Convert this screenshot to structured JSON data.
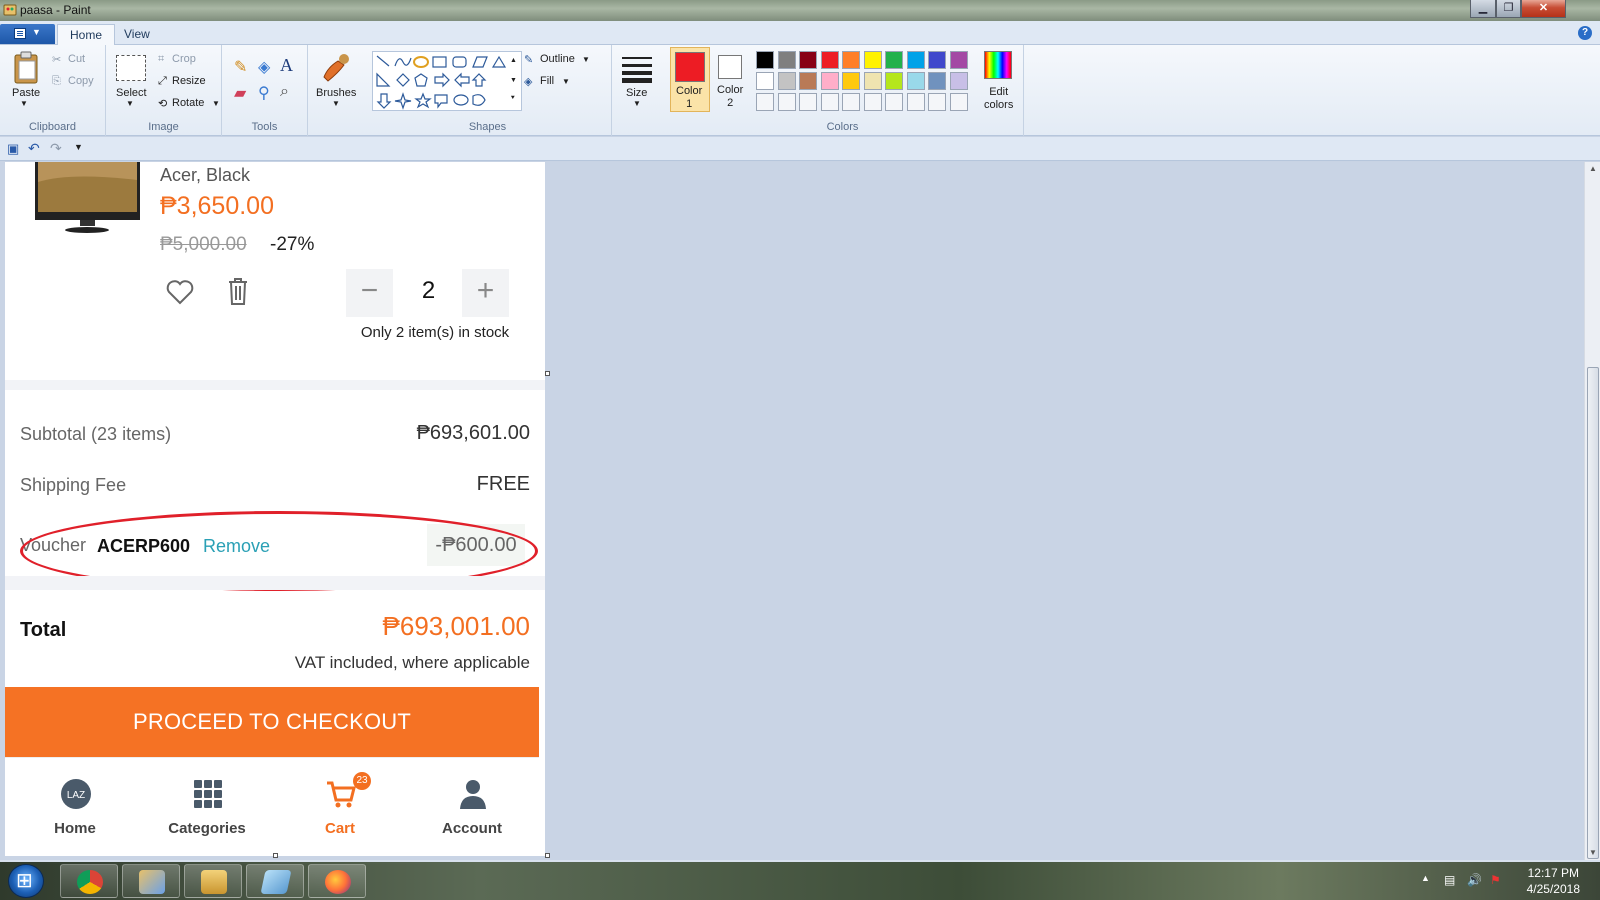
{
  "window": {
    "title": "paasa - Paint",
    "buttons": [
      "minimize",
      "maximize",
      "close"
    ]
  },
  "ribbon_tabs": [
    {
      "label": "Home",
      "active": true
    },
    {
      "label": "View",
      "active": false
    }
  ],
  "ribbon": {
    "clipboard": {
      "paste": "Paste",
      "cut": "Cut",
      "copy": "Copy",
      "group": "Clipboard"
    },
    "image": {
      "select": "Select",
      "crop": "Crop",
      "resize": "Resize",
      "rotate": "Rotate",
      "group": "Image"
    },
    "tools": {
      "group": "Tools"
    },
    "brushes": "Brushes",
    "shapes": {
      "outline": "Outline",
      "fill": "Fill",
      "group": "Shapes"
    },
    "size": "Size",
    "color1": "Color\n1",
    "color2": "Color\n2",
    "edit_colors": "Edit\ncolors",
    "colors_group": "Colors",
    "palette_row1": [
      "#000000",
      "#7f7f7f",
      "#880015",
      "#ed1c24",
      "#ff7f27",
      "#fff200",
      "#22b14c",
      "#00a2e8",
      "#3f48cc",
      "#a349a4"
    ],
    "palette_row2": [
      "#ffffff",
      "#c3c3c3",
      "#b97a57",
      "#ffaec9",
      "#ffc90e",
      "#efe4b0",
      "#b5e61d",
      "#99d9ea",
      "#7092be",
      "#c8bfe7"
    ],
    "color1_value": "#ed1c24",
    "color2_value": "#ffffff"
  },
  "canvas_content": {
    "product": {
      "name": "Acer, Black",
      "price": "₱3,650.00",
      "old_price": "₱5,000.00",
      "discount": "-27%",
      "quantity": "2",
      "stock_note": "Only 2 item(s) in stock"
    },
    "summary": {
      "subtotal_label": "Subtotal (23 items)",
      "subtotal_value": "₱693,601.00",
      "shipping_label": "Shipping Fee",
      "shipping_value": "FREE",
      "voucher_label": "Voucher",
      "voucher_code": "ACERP600",
      "voucher_remove": "Remove",
      "voucher_amount": "-₱600.00",
      "total_label": "Total",
      "total_value": "₱693,001.00",
      "vat_note": "VAT included, where applicable"
    },
    "checkout_button": "PROCEED TO CHECKOUT",
    "nav": [
      {
        "label": "Home",
        "icon": "laz-logo-icon"
      },
      {
        "label": "Categories",
        "icon": "grid-icon"
      },
      {
        "label": "Cart",
        "icon": "cart-icon",
        "badge": "23"
      },
      {
        "label": "Account",
        "icon": "person-icon"
      }
    ]
  },
  "taskbar": {
    "apps": [
      "chrome-icon",
      "paint-icon",
      "explorer-icon",
      "notes-icon",
      "firefox-icon"
    ],
    "time": "12:17 PM",
    "date": "4/25/2018"
  },
  "colors": {
    "accent_orange": "#f57224",
    "annotation_red": "#e0202a",
    "link_teal": "#2aa0b5"
  }
}
